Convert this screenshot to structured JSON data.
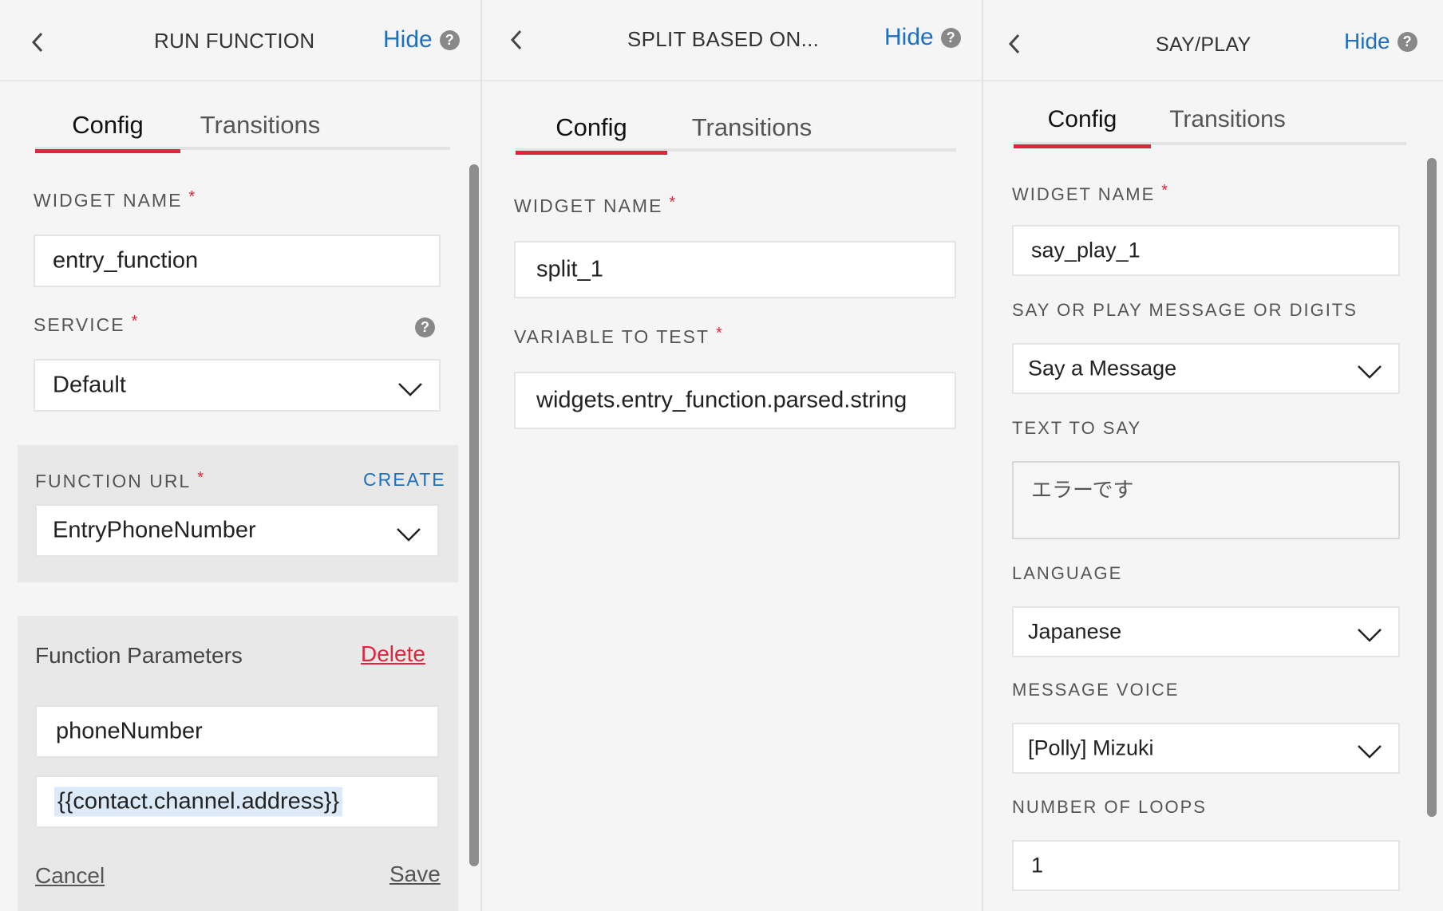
{
  "run_function": {
    "title": "RUN FUNCTION",
    "hide_label": "Hide",
    "help_glyph": "?",
    "tabs": [
      "Config",
      "Transitions"
    ],
    "widget_name_label": "WIDGET NAME",
    "widget_name_value": "entry_function",
    "service_label": "SERVICE",
    "service_value": "Default",
    "function_url_label": "FUNCTION URL",
    "create_label": "CREATE",
    "function_url_value": "EntryPhoneNumber",
    "function_parameters_label": "Function Parameters",
    "delete_label": "Delete",
    "param_key": "phoneNumber",
    "param_value": "{{contact.channel.address}}",
    "cancel_label": "Cancel",
    "save_label": "Save",
    "required_mark": "*"
  },
  "split": {
    "title": "SPLIT BASED ON...",
    "hide_label": "Hide",
    "help_glyph": "?",
    "tabs": [
      "Config",
      "Transitions"
    ],
    "widget_name_label": "WIDGET NAME",
    "widget_name_value": "split_1",
    "variable_label": "VARIABLE TO TEST",
    "variable_value": "widgets.entry_function.parsed.string",
    "required_mark": "*"
  },
  "say_play": {
    "title": "SAY/PLAY",
    "hide_label": "Hide",
    "help_glyph": "?",
    "tabs": [
      "Config",
      "Transitions"
    ],
    "widget_name_label": "WIDGET NAME",
    "widget_name_value": "say_play_1",
    "say_or_play_label": "SAY OR PLAY MESSAGE OR DIGITS",
    "say_or_play_value": "Say a Message",
    "text_to_say_label": "TEXT TO SAY",
    "text_to_say_value": "エラーです",
    "language_label": "LANGUAGE",
    "language_value": "Japanese",
    "voice_label": "MESSAGE VOICE",
    "voice_value": "[Polly] Mizuki",
    "loops_label": "NUMBER OF LOOPS",
    "loops_value": "1",
    "required_mark": "*"
  },
  "colors": {
    "accent_red": "#e0243c",
    "link_blue": "#1f6fbf"
  },
  "icons": [
    "chevron-left-icon",
    "help-icon",
    "chevron-down-icon"
  ]
}
